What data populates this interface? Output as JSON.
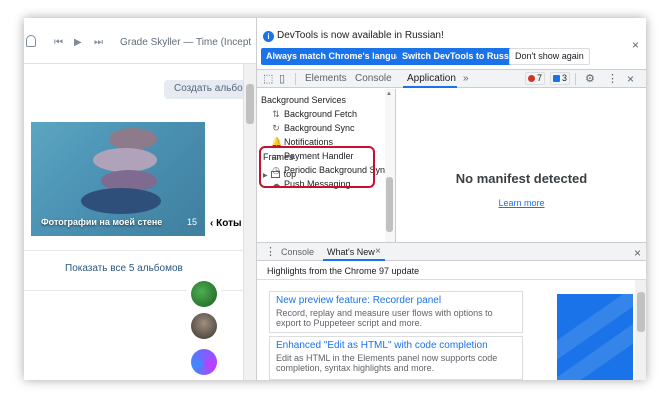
{
  "vk": {
    "track_title": "Grade Skyller — Time (Incept",
    "create_album_label": "Создать альбом",
    "album_title": "Фотографии на моей стене",
    "album_count": "15",
    "side_label": "‹ Коты",
    "show_all_label": "Показать все 5 альбомов"
  },
  "infobar": {
    "message": "DevTools is now available in Russian!",
    "btn_match": "Always match Chrome's language",
    "btn_switch": "Switch DevTools to Russian",
    "btn_dont_show": "Don't show again",
    "close": "×"
  },
  "toolbar": {
    "tabs": [
      "Elements",
      "Console",
      "Application"
    ],
    "more": "»",
    "error_count": "7",
    "message_count": "3",
    "settings": "⚙",
    "menu": "⋮",
    "close": "×"
  },
  "application": {
    "section_title": "Background Services",
    "items": [
      {
        "icon": "⇅",
        "label": "Background Fetch"
      },
      {
        "icon": "↻",
        "label": "Background Sync"
      },
      {
        "icon": "🔔",
        "label": "Notifications"
      },
      {
        "icon": "▭",
        "label": "Payment Handler"
      },
      {
        "icon": "◷",
        "label": "Periodic Background Sync"
      },
      {
        "icon": "☁",
        "label": "Push Messaging"
      }
    ],
    "frames_title": "Frames",
    "frames_top": "top",
    "no_manifest": "No manifest detected",
    "learn_more": "Learn more"
  },
  "drawer": {
    "tabs": [
      "Console",
      "What's New"
    ],
    "tab_close": "×",
    "close": "×",
    "highlights": "Highlights from the Chrome 97 update",
    "cards": [
      {
        "title": "New preview feature: Recorder panel",
        "desc": "Record, replay and measure user flows with options to export to Puppeteer script and more."
      },
      {
        "title": "Enhanced \"Edit as HTML\" with code completion",
        "desc": "Edit as HTML in the Elements panel now supports code completion, syntax highlights and more."
      }
    ]
  },
  "colors": {
    "devtools_blue": "#1a73e8",
    "highlight_red": "#c8102e",
    "error_red": "#d93025"
  }
}
